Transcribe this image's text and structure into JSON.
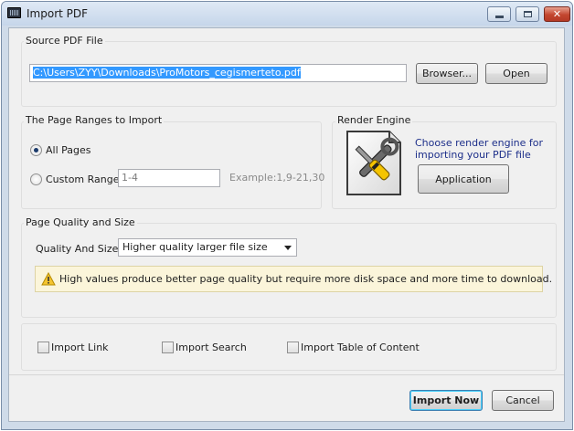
{
  "window": {
    "title": "Import PDF",
    "controls": {
      "minimize": "minimize",
      "maximize": "maximize",
      "close": "✕"
    }
  },
  "source": {
    "group_title": "Source PDF File",
    "file_path": "C:\\Users\\ZYY\\Downloads\\ProMotors_cegismerteto.pdf",
    "browse_label": "Browser...",
    "open_label": "Open"
  },
  "page_ranges": {
    "group_title": "The Page Ranges to Import",
    "all_pages_label": "All Pages",
    "custom_range_label": "Custom Range",
    "custom_range_value": "1-4",
    "example_text": "Example:1,9-21,30",
    "selected": "all_pages"
  },
  "render_engine": {
    "group_title": "Render Engine",
    "description_line1": "Choose render engine for",
    "description_line2": "importing your PDF file",
    "button_label": "Application",
    "icon": "tools-icon"
  },
  "quality": {
    "group_title": "Page Quality and Size",
    "field_label": "Quality And Size:",
    "selected_option": "Higher quality larger file size",
    "warning_text": "High values produce better page quality but require more disk space and more time to download.",
    "warning_icon": "warning-icon"
  },
  "options": {
    "import_link": {
      "label": "Import Link",
      "checked": false
    },
    "import_search": {
      "label": "Import Search",
      "checked": false
    },
    "import_toc": {
      "label": "Import Table of Content",
      "checked": false
    }
  },
  "footer": {
    "import_now_label": "Import Now",
    "cancel_label": "Cancel"
  }
}
